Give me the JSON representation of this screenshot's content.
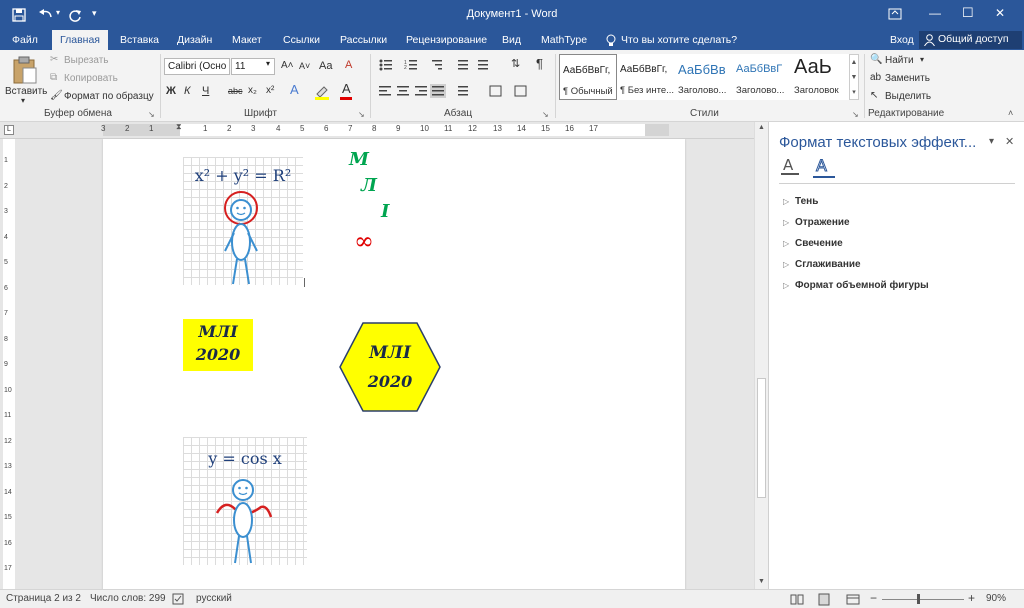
{
  "titlebar": {
    "title": "Документ1 - Word",
    "minimize": "—",
    "restore": "☐",
    "close": "✕"
  },
  "tabs": [
    {
      "label": "Файл"
    },
    {
      "label": "Главная"
    },
    {
      "label": "Вставка"
    },
    {
      "label": "Дизайн"
    },
    {
      "label": "Макет"
    },
    {
      "label": "Ссылки"
    },
    {
      "label": "Рассылки"
    },
    {
      "label": "Рецензирование"
    },
    {
      "label": "Вид"
    },
    {
      "label": "MathType"
    }
  ],
  "tellme": "Что вы хотите сделать?",
  "signin": "Вход",
  "share": "Общий доступ",
  "clipboard": {
    "paste": "Вставить",
    "cut": "Вырезать",
    "copy": "Копировать",
    "format_painter": "Формат по образцу",
    "group": "Буфер обмена"
  },
  "font": {
    "name": "Calibri (Осно",
    "size": "11",
    "group": "Шрифт",
    "bold": "Ж",
    "italic": "К",
    "underline": "Ч",
    "strike": "abc",
    "sub": "x₂",
    "sup": "x²",
    "grow": "A˄",
    "shrink": "A˅",
    "case": "Aa",
    "clear": "A"
  },
  "paragraph": {
    "group": "Абзац",
    "pilcrow": "¶"
  },
  "styles": {
    "group": "Стили",
    "items": [
      {
        "preview": "АаБбВвГг,",
        "name": "¶ Обычный"
      },
      {
        "preview": "АаБбВвГг,",
        "name": "¶ Без инте..."
      },
      {
        "preview": "АаБбВв",
        "name": "Заголово..."
      },
      {
        "preview": "АаБбВвГ",
        "name": "Заголово..."
      },
      {
        "preview": "АаЬ",
        "name": "Заголовок"
      }
    ]
  },
  "editing": {
    "find": "Найти",
    "replace": "Заменить",
    "select": "Выделить",
    "group": "Редактирование"
  },
  "document": {
    "formula1": "x² + y² = R²",
    "letters": [
      "М",
      "Л",
      "I"
    ],
    "infinity": "∞",
    "box_text": [
      "МЛI",
      "2020"
    ],
    "hex_text": [
      "МЛI",
      "2020"
    ],
    "formula2": "y = cos x"
  },
  "pane": {
    "title": "Формат текстовых эффект...",
    "items": [
      "Тень",
      "Отражение",
      "Свечение",
      "Сглаживание",
      "Формат объемной фигуры"
    ],
    "close": "✕",
    "menu": "▾"
  },
  "ruler": {
    "h_marks": [
      "3",
      "2",
      "1",
      "1",
      "2",
      "3",
      "4",
      "5",
      "6",
      "7",
      "8",
      "9",
      "10",
      "11",
      "12",
      "13",
      "14",
      "15",
      "16",
      "17"
    ],
    "v_marks": [
      "1",
      "2",
      "3",
      "4",
      "5",
      "6",
      "7",
      "8",
      "9",
      "10",
      "11",
      "12",
      "13",
      "14",
      "15",
      "16",
      "17"
    ]
  },
  "status": {
    "page": "Страница 2 из 2",
    "words": "Число слов: 299",
    "lang": "русский",
    "zoom": "90%"
  },
  "colors": {
    "accent": "#2b579a",
    "yellow": "#ffff00",
    "green": "#00a550",
    "red": "#e00000"
  }
}
